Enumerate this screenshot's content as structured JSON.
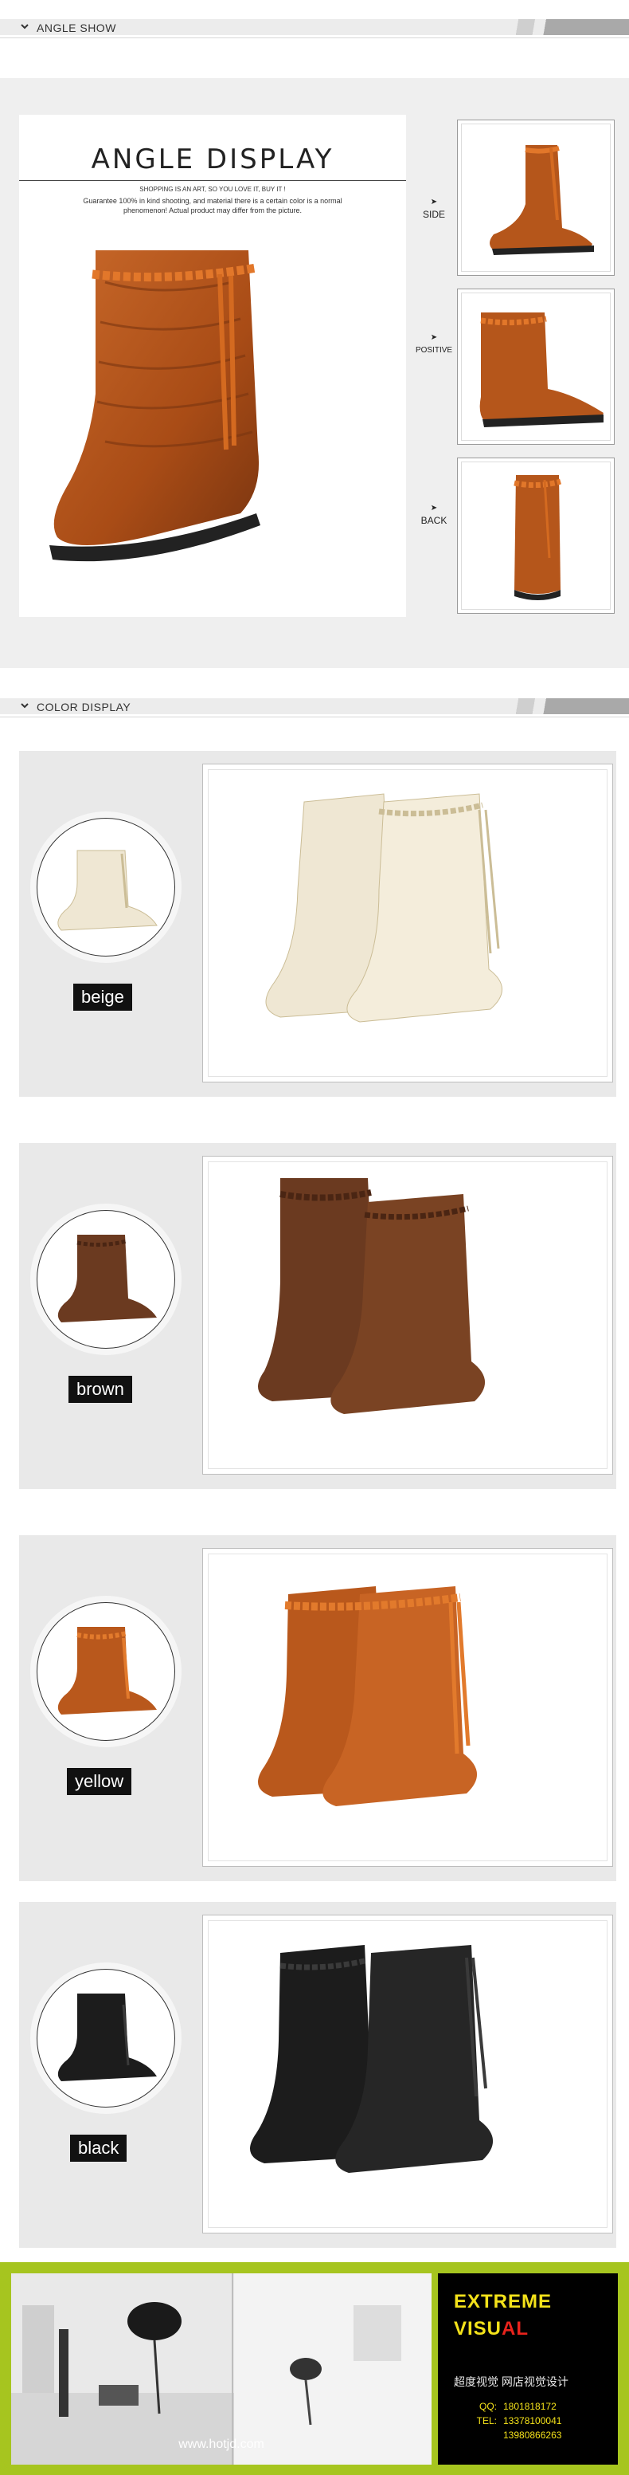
{
  "angle_section": {
    "header_label": "ANGLE SHOW",
    "title": "ANGLE DISPLAY",
    "subtitle_line1": "SHOPPING IS AN ART, SO YOU LOVE IT, BUY IT !",
    "subtitle_line2": "Guarantee 100% in kind shooting, and material there is a certain color is a normal",
    "subtitle_line3": "phenomenon! Actual product may differ from the picture.",
    "views": [
      {
        "arrow": "➤",
        "label": "SIDE"
      },
      {
        "arrow": "➤",
        "label": "POSITIVE"
      },
      {
        "arrow": "➤",
        "label": "BACK"
      }
    ]
  },
  "color_section": {
    "header_label": "COLOR DISPLAY",
    "colors": [
      {
        "name": "beige",
        "swatch": "#efe7d3",
        "trim": "#cbbd96"
      },
      {
        "name": "brown",
        "swatch": "#6b3a20",
        "trim": "#4a2513"
      },
      {
        "name": "yellow",
        "swatch": "#b9581c",
        "trim": "#e27a2c"
      },
      {
        "name": "black",
        "swatch": "#1c1c1c",
        "trim": "#3a3a3a"
      }
    ]
  },
  "footer": {
    "brand_line1": "EXTREME",
    "brand_line2_prefix": "VISU",
    "brand_line2_red": "AL",
    "brand_cn": "超度视觉 网店视觉设计",
    "qq_label": "QQ:",
    "qq_value": "1801818172",
    "tel_label": "TEL:",
    "tel_value1": "13378100041",
    "tel_value2": "13980866263",
    "url": "www.hotjd.com"
  },
  "colors": {
    "leather_main": "#b5561b",
    "leather_dark": "#7a3510",
    "braid": "#e2772a",
    "footer_green": "#a6c51f",
    "brand_yellow": "#f4e21a",
    "brand_red": "#e8231c"
  }
}
